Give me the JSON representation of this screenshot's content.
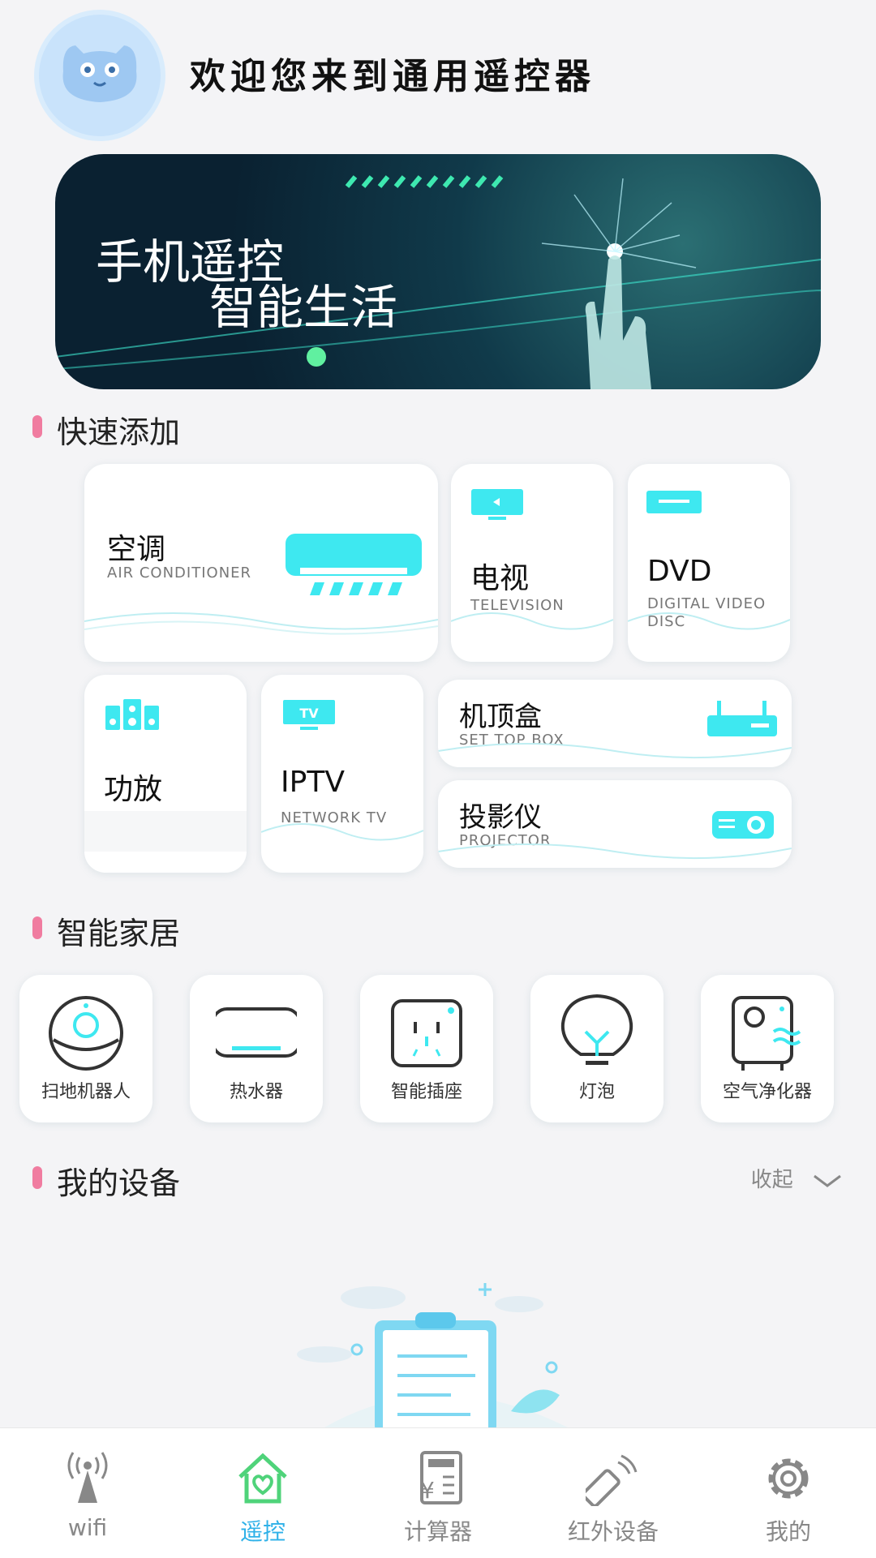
{
  "header": {
    "welcome": "欢迎您来到通用遥控器"
  },
  "banner": {
    "line1": "手机遥控",
    "line2": "智能生活"
  },
  "quick_add": {
    "title": "快速添加",
    "items": [
      {
        "zh": "空调",
        "en": "AIR CONDITIONER"
      },
      {
        "zh": "电视",
        "en": "TELEVISION"
      },
      {
        "zh": "DVD",
        "en": "DIGITAL VIDEO DISC"
      },
      {
        "zh": "功放",
        "en": ""
      },
      {
        "zh": "IPTV",
        "en": "NETWORK TV"
      },
      {
        "zh": "机顶盒",
        "en": "SET TOP BOX"
      },
      {
        "zh": "投影仪",
        "en": "PROJECTOR"
      }
    ]
  },
  "smart_home": {
    "title": "智能家居",
    "items": [
      {
        "label": "扫地机器人",
        "icon": "robot-vacuum-icon"
      },
      {
        "label": "热水器",
        "icon": "water-heater-icon"
      },
      {
        "label": "智能插座",
        "icon": "smart-socket-icon"
      },
      {
        "label": "灯泡",
        "icon": "light-bulb-icon"
      },
      {
        "label": "空气净化器",
        "icon": "air-purifier-icon"
      }
    ]
  },
  "my_devices": {
    "title": "我的设备",
    "collapse_label": "收起"
  },
  "nav": {
    "items": [
      {
        "label": "wifi",
        "icon": "wifi-tower-icon"
      },
      {
        "label": "遥控",
        "icon": "home-heart-icon",
        "active": true
      },
      {
        "label": "计算器",
        "icon": "calculator-icon"
      },
      {
        "label": "红外设备",
        "icon": "infrared-remote-icon"
      },
      {
        "label": "我的",
        "icon": "gear-icon"
      }
    ]
  },
  "colors": {
    "accent": "#2fb1e8",
    "icon_cyan": "#3ee8f0",
    "section_marker": "#f07ca0"
  }
}
